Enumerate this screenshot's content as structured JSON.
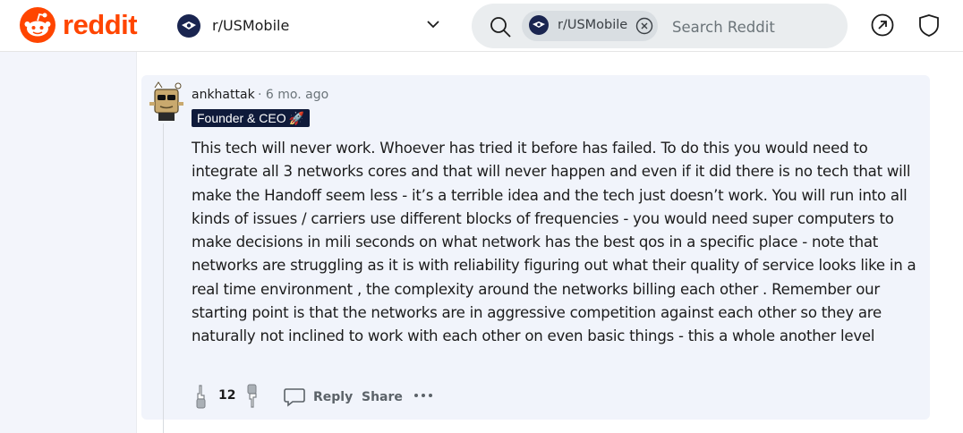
{
  "header": {
    "brand": "reddit",
    "subreddit": "r/USMobile",
    "search": {
      "chip_label": "r/USMobile",
      "placeholder": "Search Reddit"
    },
    "icons": [
      "reddit-logo-icon",
      "subreddit-icon",
      "chevron-down-icon",
      "search-icon",
      "close-icon",
      "popular-icon",
      "moderation-icon"
    ]
  },
  "comment": {
    "author": "ankhattak",
    "meta": "· 6 mo. ago",
    "flair": "Founder & CEO",
    "flair_emoji": "🚀",
    "body": "This tech will never work. Whoever has tried it before has failed. To do this you would need to integrate all 3 networks cores and that will never happen and even if it did there is no tech that will make the Handoff seem less - it’s a terrible idea and the tech just doesn’t work. You will run into all kinds of issues / carriers use different blocks of frequencies - you would need super computers to make decisions in mili seconds on what network has the best qos in a specific place - note that networks are struggling as it is with reliability figuring out what their quality of service looks like in a real time environment , the complexity around the networks billing each other . Remember our starting point is that the networks are in aggressive competition against each other so they are naturally not inclined to work with each other on even basic things - this a whole another level",
    "score": "12",
    "reply_label": "Reply",
    "share_label": "Share",
    "more_label": "•••"
  },
  "colors": {
    "brand": "#ff4500",
    "card_bg": "#f1f4fb",
    "flair_bg": "#0f1a3a",
    "search_bg": "#eaedef"
  }
}
